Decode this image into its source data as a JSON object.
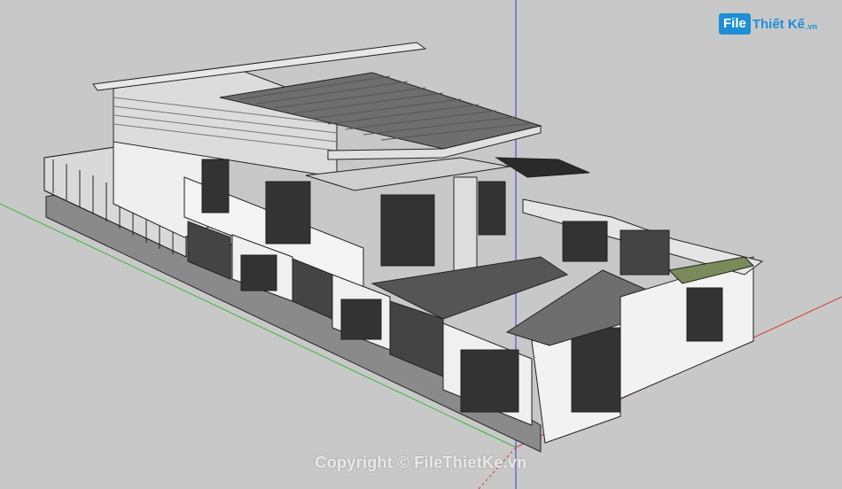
{
  "watermark": {
    "logo_badge": "File",
    "logo_rest": "Thiết Kế",
    "logo_tld": ".vn",
    "copyright": "Copyright © FileThietKe.vn"
  },
  "colors": {
    "viewport_bg": "#c8c8c8",
    "axis_red": "#d23c3c",
    "axis_green": "#3cb43c",
    "axis_blue": "#3c3cd2",
    "roof": "#6e6e6e",
    "wall": "#f2f2f2",
    "fence_base": "#8a8a8a",
    "logo_blue": "#1e8fd6"
  },
  "icons": [
    "sketchup-axes-icon",
    "filethietke-logo-icon"
  ]
}
